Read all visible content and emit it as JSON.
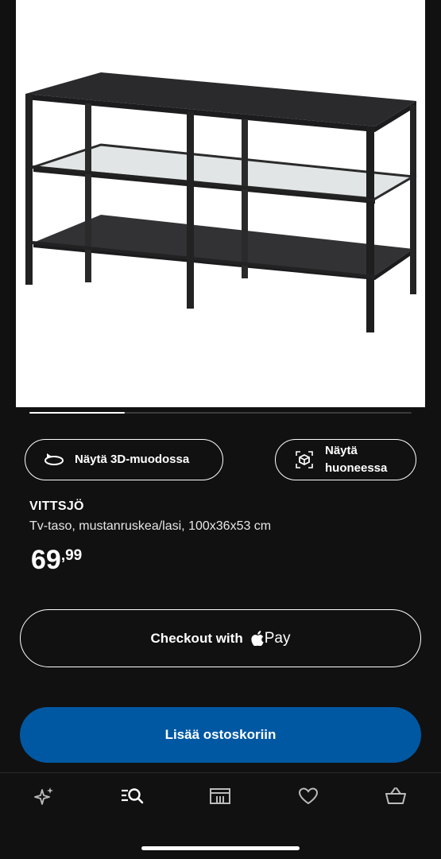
{
  "product": {
    "image_alt": "VITTSJÖ tv-taso",
    "carousel_progress": 0.25,
    "name": "VITTSJÖ",
    "description": "Tv-taso, mustanruskea/lasi, 100x36x53 cm",
    "price_integer": "69",
    "price_decimal": ",99"
  },
  "actions": {
    "view_3d_label": "Näytä 3D-muodossa",
    "view_3d_icon": "rotate-3d-icon",
    "view_room_label": "Näytä huoneessa",
    "view_room_icon": "ar-cube-icon",
    "apple_pay_prefix": "Checkout with",
    "apple_pay_suffix": "Pay",
    "add_to_cart_label": "Lisää ostoskoriin"
  },
  "tabbar": {
    "items": [
      {
        "icon": "sparkle-icon"
      },
      {
        "icon": "search-list-icon",
        "active": true
      },
      {
        "icon": "store-icon"
      },
      {
        "icon": "heart-icon"
      },
      {
        "icon": "basket-icon"
      }
    ]
  },
  "colors": {
    "background": "#111111",
    "primary_button": "#0058a3",
    "text": "#ffffff"
  }
}
